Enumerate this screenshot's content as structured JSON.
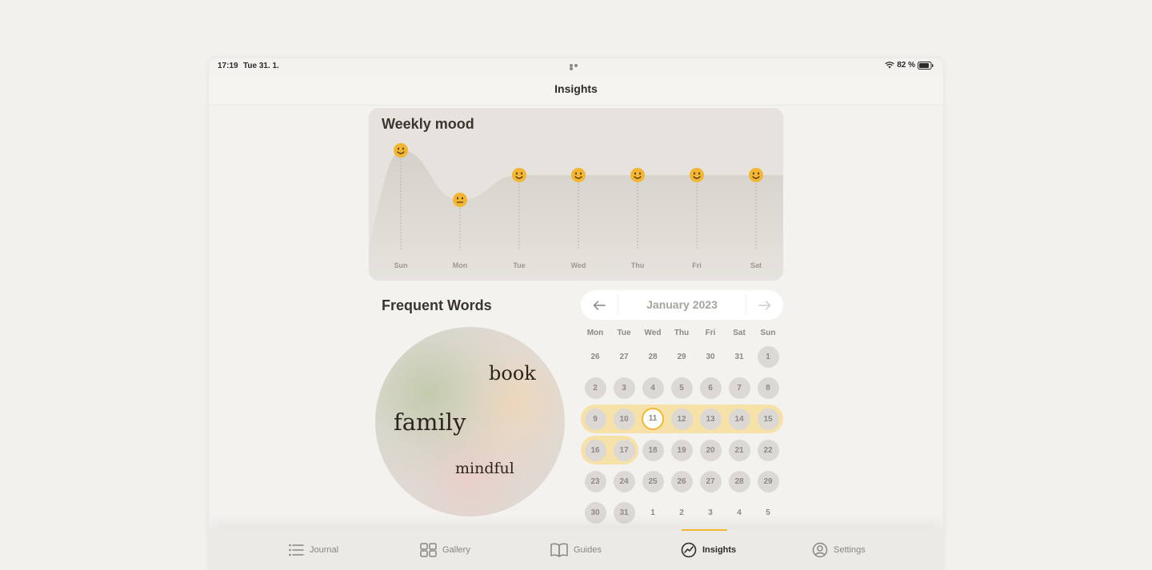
{
  "status": {
    "time": "17:19",
    "date": "Tue 31. 1.",
    "battery": "82 %"
  },
  "nav": {
    "title": "Insights"
  },
  "weekly_mood": {
    "title": "Weekly mood",
    "days": [
      "Sun",
      "Mon",
      "Tue",
      "Wed",
      "Thu",
      "Fri",
      "Sat"
    ],
    "moods": [
      "happy",
      "neutral",
      "happy",
      "happy",
      "happy",
      "happy",
      "happy"
    ]
  },
  "chart_data": {
    "type": "area",
    "title": "Weekly mood",
    "categories": [
      "Sun",
      "Mon",
      "Tue",
      "Wed",
      "Thu",
      "Fri",
      "Sat"
    ],
    "values": [
      5,
      3,
      4,
      4,
      4,
      4,
      4
    ],
    "ylim": [
      0,
      5
    ]
  },
  "frequent_words": {
    "title": "Frequent Words",
    "words": [
      "book",
      "family",
      "mindful"
    ]
  },
  "calendar": {
    "month_label": "January 2023",
    "weekdays": [
      "Mon",
      "Tue",
      "Wed",
      "Thu",
      "Fri",
      "Sat",
      "Sun"
    ],
    "weeks": [
      [
        {
          "d": "26"
        },
        {
          "d": "27"
        },
        {
          "d": "28"
        },
        {
          "d": "29"
        },
        {
          "d": "30"
        },
        {
          "d": "31"
        },
        {
          "d": "1",
          "filled": true
        }
      ],
      [
        {
          "d": "2",
          "filled": true
        },
        {
          "d": "3",
          "filled": true
        },
        {
          "d": "4",
          "filled": true
        },
        {
          "d": "5",
          "filled": true
        },
        {
          "d": "6",
          "filled": true
        },
        {
          "d": "7",
          "filled": true
        },
        {
          "d": "8",
          "filled": true
        }
      ],
      [
        {
          "d": "9",
          "filled": true
        },
        {
          "d": "10",
          "filled": true
        },
        {
          "d": "11",
          "today": true
        },
        {
          "d": "12",
          "filled": true
        },
        {
          "d": "13",
          "filled": true
        },
        {
          "d": "14",
          "filled": true
        },
        {
          "d": "15",
          "filled": true
        }
      ],
      [
        {
          "d": "16",
          "filled": true
        },
        {
          "d": "17",
          "filled": true
        },
        {
          "d": "18",
          "filled": true
        },
        {
          "d": "19",
          "filled": true
        },
        {
          "d": "20",
          "filled": true
        },
        {
          "d": "21",
          "filled": true
        },
        {
          "d": "22",
          "filled": true
        }
      ],
      [
        {
          "d": "23",
          "filled": true
        },
        {
          "d": "24",
          "filled": true
        },
        {
          "d": "25",
          "filled": true
        },
        {
          "d": "26",
          "filled": true
        },
        {
          "d": "27",
          "filled": true
        },
        {
          "d": "28",
          "filled": true
        },
        {
          "d": "29",
          "filled": true
        }
      ],
      [
        {
          "d": "30",
          "filled": true
        },
        {
          "d": "31",
          "filled": true
        },
        {
          "d": "1"
        },
        {
          "d": "2"
        },
        {
          "d": "3"
        },
        {
          "d": "4"
        },
        {
          "d": "5"
        }
      ]
    ],
    "highlighted_weeks": [
      {
        "week": 2,
        "from_day": 0,
        "to_day": 6
      },
      {
        "week": 3,
        "from_day": 0,
        "to_day": 1
      }
    ]
  },
  "tabs": [
    {
      "label": "Journal",
      "icon": "list-icon",
      "active": false
    },
    {
      "label": "Gallery",
      "icon": "grid-icon",
      "active": false
    },
    {
      "label": "Guides",
      "icon": "book-icon",
      "active": false
    },
    {
      "label": "Insights",
      "icon": "insights-icon",
      "active": true
    },
    {
      "label": "Settings",
      "icon": "person-circle-icon",
      "active": false
    }
  ],
  "colors": {
    "accent": "#f0b731",
    "highlight": "#f6e1a9",
    "card": "#e6e3de"
  }
}
